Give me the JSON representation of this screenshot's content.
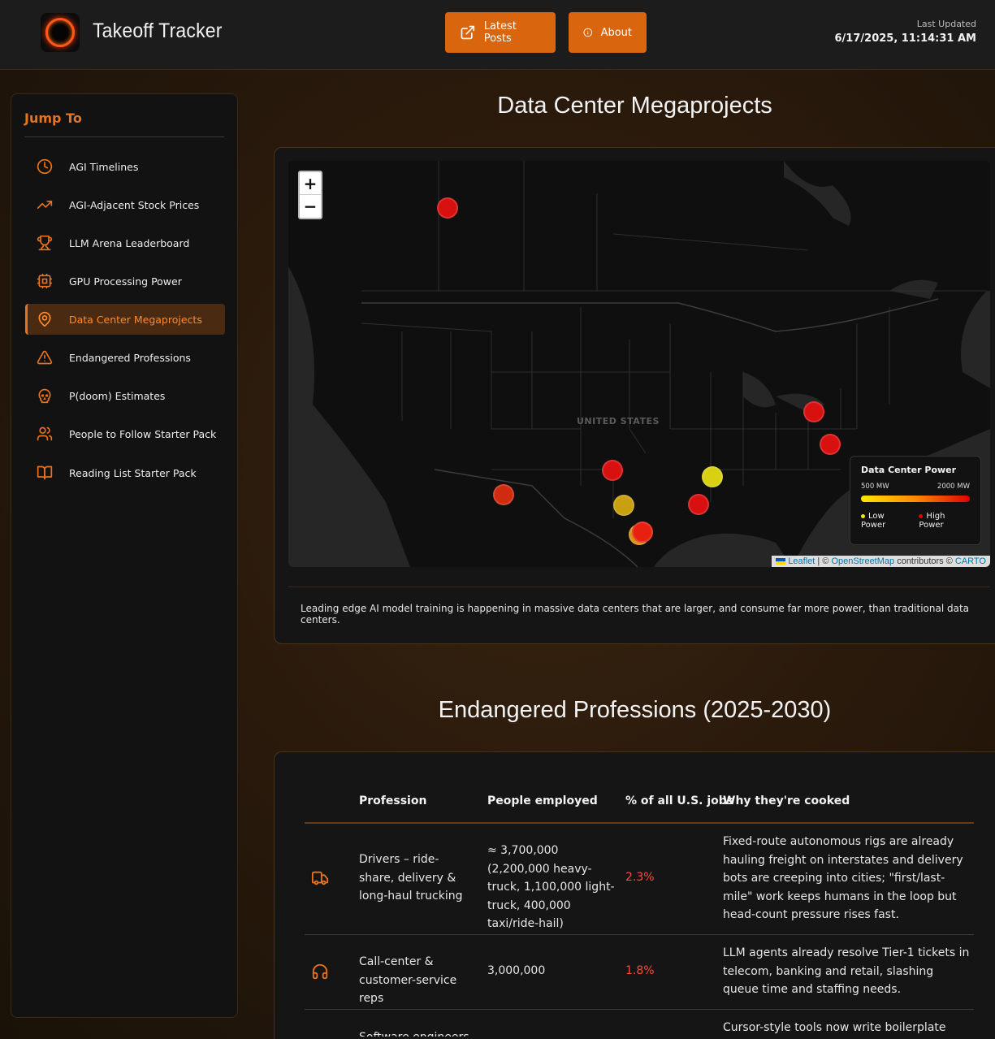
{
  "header": {
    "app_title": "Takeoff Tracker",
    "latest_posts_label": "Latest Posts",
    "about_label": "About",
    "last_updated_label": "Last Updated",
    "last_updated_value": "6/17/2025, 11:14:31 AM"
  },
  "sidebar": {
    "title": "Jump To",
    "items": [
      {
        "label": "AGI Timelines",
        "icon": "clock-icon"
      },
      {
        "label": "AGI-Adjacent Stock Prices",
        "icon": "trending-up-icon"
      },
      {
        "label": "LLM Arena Leaderboard",
        "icon": "trophy-icon"
      },
      {
        "label": "GPU Processing Power",
        "icon": "cpu-icon"
      },
      {
        "label": "Data Center Megaprojects",
        "icon": "map-pin-icon",
        "active": true
      },
      {
        "label": "Endangered Professions",
        "icon": "warning-icon"
      },
      {
        "label": "P(doom) Estimates",
        "icon": "skull-icon"
      },
      {
        "label": "People to Follow Starter Pack",
        "icon": "users-icon"
      },
      {
        "label": "Reading List Starter Pack",
        "icon": "book-icon"
      }
    ]
  },
  "datacenters": {
    "title": "Data Center Megaprojects",
    "map": {
      "zoom_in": "+",
      "zoom_out": "−",
      "country_label": "UNITED STATES",
      "attribution": {
        "leaflet": "Leaflet",
        "sep1": " | © ",
        "osm": "OpenStreetMap",
        "contrib": " contributors © ",
        "carto": "CARTO"
      }
    },
    "legend": {
      "title": "Data Center Power",
      "min_label": "500 MW",
      "max_label": "2000 MW",
      "low_label": "Low Power",
      "high_label": "High Power",
      "low_color": "#ffe600",
      "high_color": "#e00000"
    },
    "caption": "Leading edge AI model training is happening in massive data centers that are larger, and consume far more power, than traditional data centers."
  },
  "professions": {
    "title": "Endangered Professions (2025-2030)",
    "headers": [
      "Profession",
      "People employed",
      "% of all U.S. jobs",
      "Why they're cooked"
    ],
    "rows": [
      {
        "icon": "truck-icon",
        "profession": "Drivers – ride-share, delivery & long-haul trucking",
        "employed": "≈ 3,700,000 (2,200,000 heavy-truck, 1,100,000 light-truck, 400,000 taxi/ride-hail)",
        "pct": "2.3%",
        "why": "Fixed-route autonomous rigs are already hauling freight on interstates and delivery bots are creeping into cities; \"first/last-mile\" work keeps humans in the loop but head-count pressure rises fast."
      },
      {
        "icon": "headset-icon",
        "profession": "Call-center & customer-service reps",
        "employed": "3,000,000",
        "pct": "1.8%",
        "why": "LLM agents already resolve Tier-1 tickets in telecom, banking and retail, slashing queue time and staffing needs."
      },
      {
        "icon": "code-icon",
        "profession": "Software engineers",
        "employed": "",
        "pct": "",
        "why": "Cursor-style tools now write boilerplate and even"
      }
    ]
  }
}
